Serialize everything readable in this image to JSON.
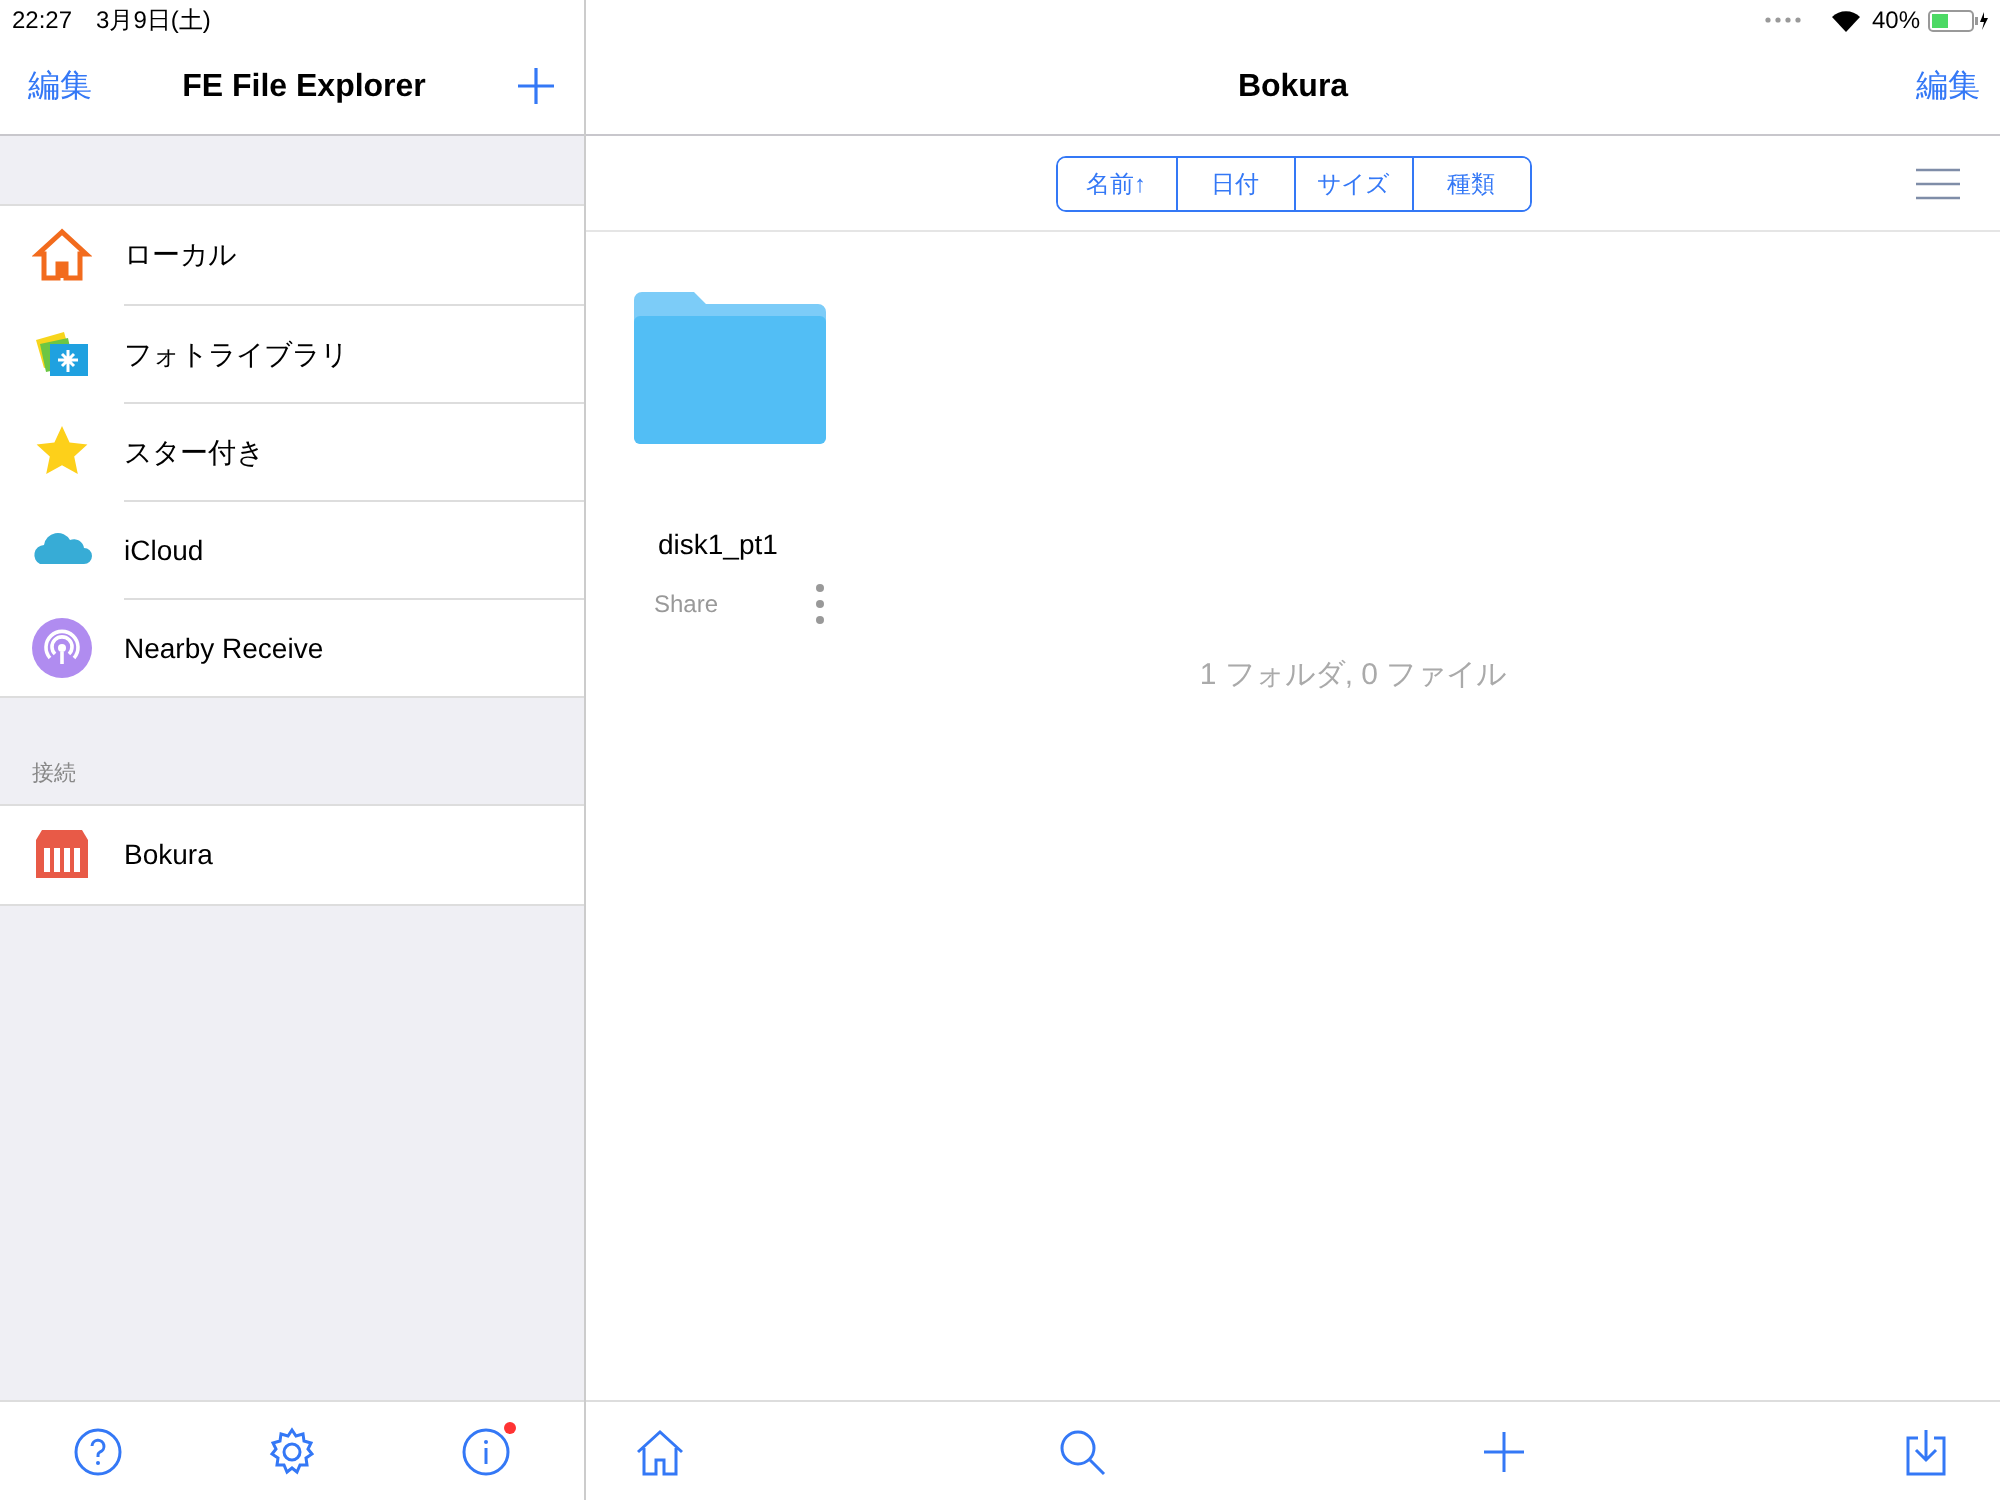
{
  "status_bar": {
    "time": "22:27",
    "date": "3月9日(土)",
    "battery": "40%"
  },
  "sidebar": {
    "edit": "編集",
    "title": "FE File Explorer",
    "items": [
      {
        "kind": "house",
        "label": "ローカル"
      },
      {
        "kind": "photos",
        "label": "フォトライブラリ"
      },
      {
        "kind": "star",
        "label": "スター付き"
      },
      {
        "kind": "cloud",
        "label": "iCloud"
      },
      {
        "kind": "nearby",
        "label": "Nearby Receive"
      }
    ],
    "section": "接続",
    "connections": [
      {
        "kind": "nas",
        "label": "Bokura"
      }
    ],
    "toolbar": [
      {
        "kind": "help",
        "badge": false
      },
      {
        "kind": "settings",
        "badge": false
      },
      {
        "kind": "info",
        "badge": true
      }
    ]
  },
  "main": {
    "title": "Bokura",
    "edit": "編集",
    "sort": [
      "名前↑",
      "日付",
      "サイズ",
      "種類"
    ],
    "files": [
      {
        "name": "disk1_pt1",
        "subtitle": "Share"
      }
    ],
    "summary": "1 フォルダ, 0 ファイル",
    "toolbar": [
      {
        "kind": "home"
      },
      {
        "kind": "search"
      },
      {
        "kind": "add"
      },
      {
        "kind": "import"
      }
    ]
  }
}
